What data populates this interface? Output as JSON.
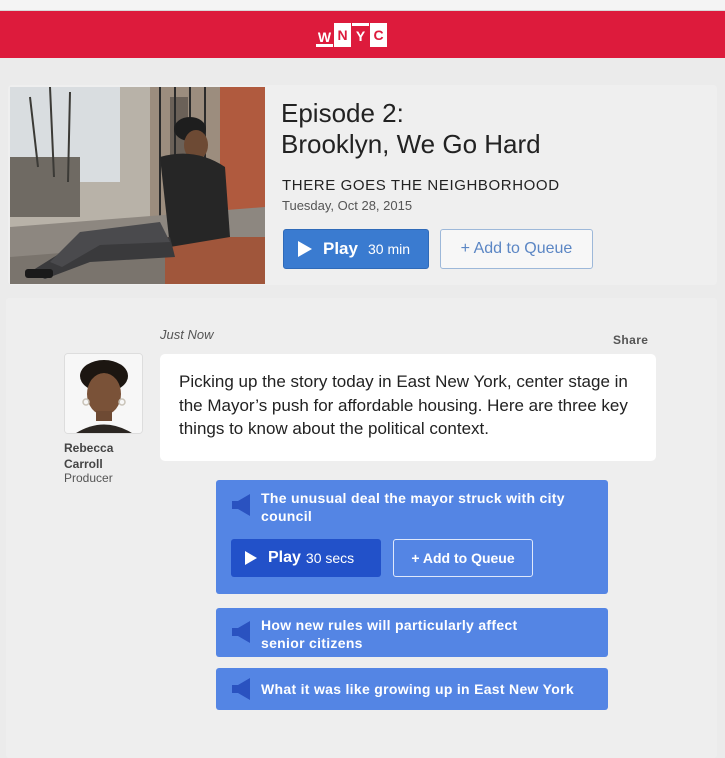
{
  "header": {
    "logo_letters": [
      "W",
      "N",
      "Y",
      "C"
    ],
    "brand_color": "#dd1b3c"
  },
  "episode": {
    "title_line1": "Episode 2:",
    "title_line2": "Brooklyn, We Go Hard",
    "show": "THERE GOES THE NEIGHBORHOOD",
    "date": "Tuesday, Oct 28, 2015",
    "play_label": "Play",
    "duration": "30 min",
    "queue_label": "+ Add to Queue"
  },
  "feed": {
    "timestamp": "Just Now",
    "share_label": "Share",
    "author": {
      "name": "Rebecca Carroll",
      "role": "Producer"
    },
    "post_text": "Picking up the story today in East New York, center stage in the Mayor’s push for affordable housing. Here are three key things to know about the political context."
  },
  "clips": [
    {
      "title": "The unusual deal the mayor struck with city council",
      "play_label": "Play",
      "duration": "30 secs",
      "queue_label": "+ Add to Queue"
    },
    {
      "title": "How new rules will particularly affect senior citizens"
    },
    {
      "title": "What it was like growing up in East New York"
    }
  ],
  "colors": {
    "primary_blue": "#3a7bd0",
    "clip_blue": "#5485e4",
    "clip_play_blue": "#2251c9"
  },
  "icons": [
    "play-icon",
    "speaker-icon"
  ]
}
